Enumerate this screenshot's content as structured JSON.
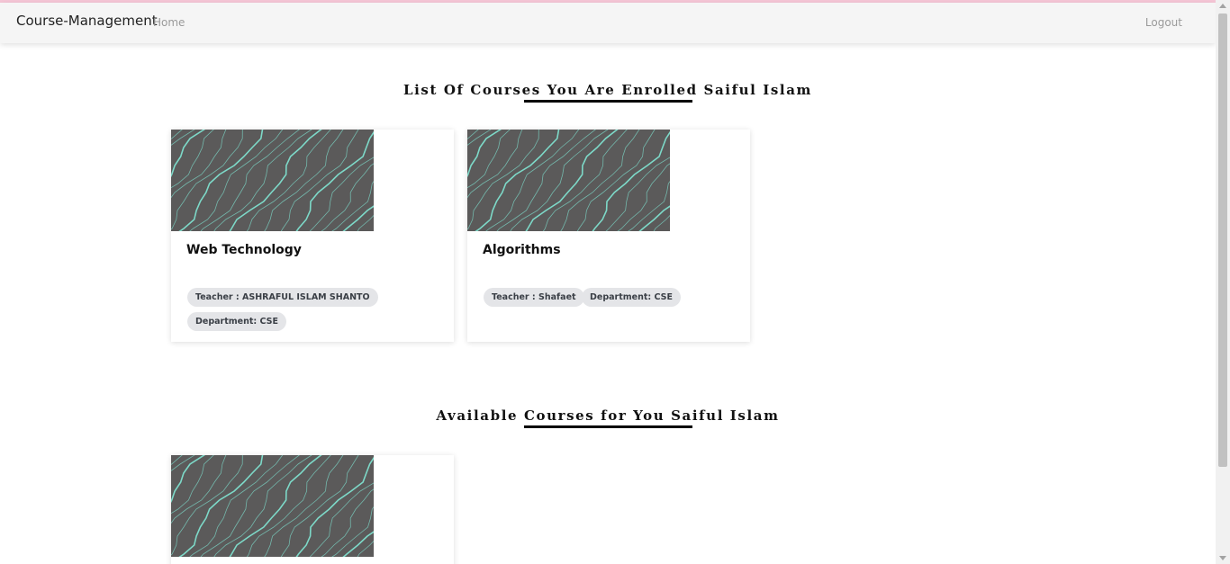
{
  "navbar": {
    "brand": "Course-Management",
    "home": "Home",
    "logout": "Logout"
  },
  "enrolled": {
    "title": "List Of Courses You Are Enrolled Saiful Islam",
    "courses": [
      {
        "name": "Web Technology",
        "teacher": "Teacher : ASHRAFUL ISLAM SHANTO",
        "department": "Department: CSE"
      },
      {
        "name": "Algorithms",
        "teacher": "Teacher : Shafaet",
        "department": "Department: CSE"
      }
    ]
  },
  "available": {
    "title": "Available Courses for You Saiful Islam"
  },
  "colors": {
    "thumbnail_bg": "#5b5a5a",
    "contour_line": "#7fe0cf",
    "badge_bg": "#e4e5e8"
  }
}
